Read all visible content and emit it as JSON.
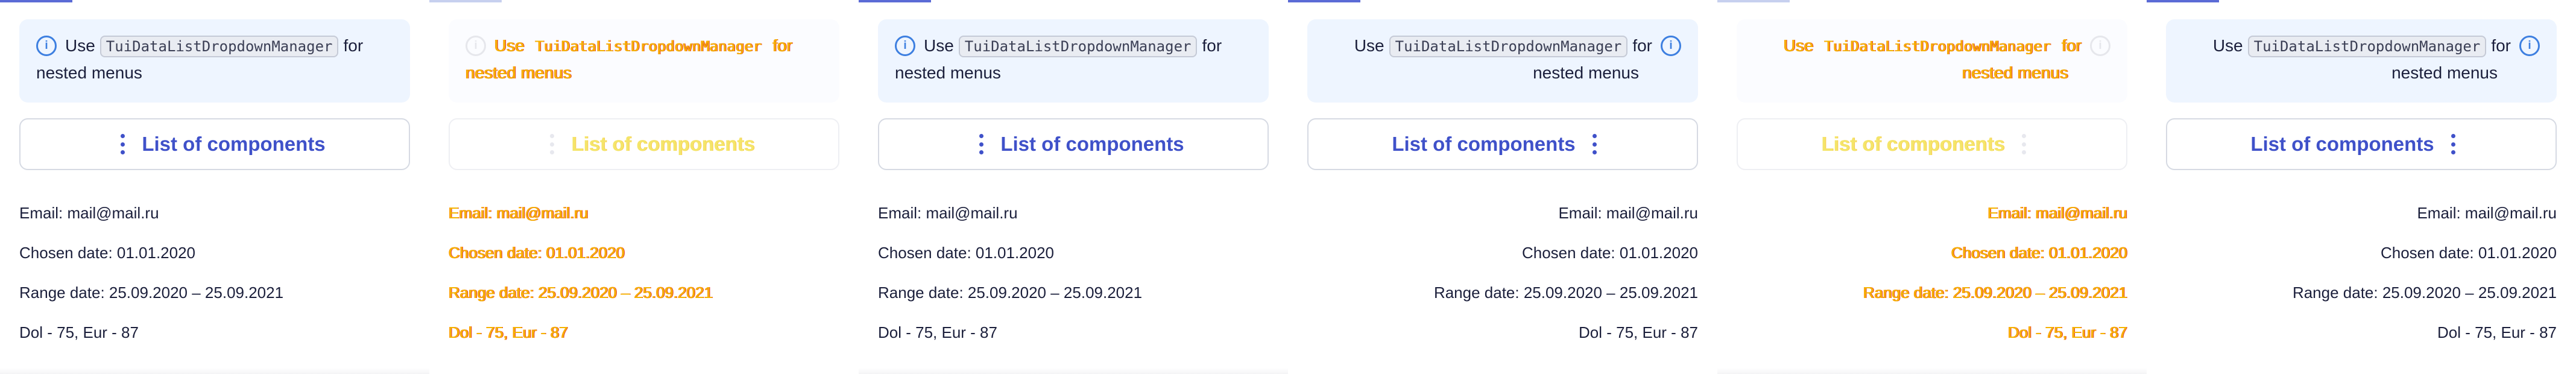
{
  "hint": {
    "prefix": "Use",
    "code": "TuiDataListDropdownManager",
    "suffix": "for",
    "line2": "nested menus",
    "info_icon": "info-circle-icon"
  },
  "button": {
    "label": "List of components",
    "icon": "more-vertical-icon"
  },
  "details": {
    "email": "Email: mail@mail.ru",
    "chosen_date": "Chosen date: 01.01.2020",
    "range_date": "Range date: 25.09.2020 – 25.09.2021",
    "currency": "Dol - 75, Eur - 87"
  },
  "colors": {
    "accent": "#3f51c9",
    "hint_bg": "#eef5ff",
    "info": "#3d7fe0",
    "glitch_text": "#f4b400"
  }
}
